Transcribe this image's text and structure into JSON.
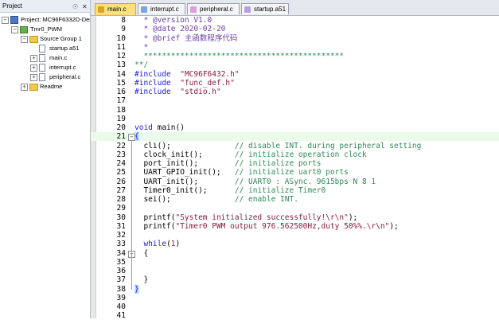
{
  "project_panel": {
    "title": "Project",
    "pin_icon": "pin-icon",
    "close_icon": "close-icon",
    "tree": [
      {
        "label": "Project: MC96F6332D-Den",
        "indent": 0,
        "expander": "−",
        "icon": "project"
      },
      {
        "label": "Tmr0_PWM",
        "indent": 1,
        "expander": "−",
        "icon": "target"
      },
      {
        "label": "Source Group 1",
        "indent": 2,
        "expander": "−",
        "icon": "folder"
      },
      {
        "label": "startup.a51",
        "indent": 3,
        "expander": "",
        "icon": "file"
      },
      {
        "label": "main.c",
        "indent": 3,
        "expander": "+",
        "icon": "file"
      },
      {
        "label": "interrupt.c",
        "indent": 3,
        "expander": "+",
        "icon": "file"
      },
      {
        "label": "peripheral.c",
        "indent": 3,
        "expander": "+",
        "icon": "file"
      },
      {
        "label": "Readme",
        "indent": 2,
        "expander": "+",
        "icon": "folder"
      }
    ]
  },
  "tabs": [
    {
      "label": "main.c",
      "active": true,
      "color": "#e0a020"
    },
    {
      "label": "interrupt.c",
      "active": false,
      "color": "#7aa7e0"
    },
    {
      "label": "peripheral.c",
      "active": false,
      "color": "#d9a0d9"
    },
    {
      "label": "startup.a51",
      "active": false,
      "color": "#b8a0e0"
    }
  ],
  "editor": {
    "current_line": 21,
    "lines": [
      {
        "n": "8",
        "text": "  * @version V1.0",
        "cls": "c-comment"
      },
      {
        "n": "9",
        "text": "  * @date 2020-02-20",
        "cls": "c-comment"
      },
      {
        "n": "10",
        "text": "  * @brief 主函数程序代码",
        "cls": "c-comment"
      },
      {
        "n": "11",
        "text": "  *",
        "cls": "c-comment"
      },
      {
        "n": "12",
        "text": "  ********************************************",
        "cls": "c-green"
      },
      {
        "n": "13",
        "text": "**/",
        "cls": "c-green"
      },
      {
        "n": "14",
        "text": "#include  \"MC96F6432.h\"",
        "cls": "inc"
      },
      {
        "n": "15",
        "text": "#include  \"func_def.h\"",
        "cls": "inc"
      },
      {
        "n": "16",
        "text": "#include  \"stdio.h\"",
        "cls": "inc"
      },
      {
        "n": "17",
        "text": "",
        "cls": "c-plain"
      },
      {
        "n": "18",
        "text": "",
        "cls": "c-plain"
      },
      {
        "n": "19",
        "text": "",
        "cls": "c-plain"
      },
      {
        "n": "20",
        "text": "void main()",
        "cls": "fn"
      },
      {
        "n": "21",
        "text": "{",
        "cls": "open"
      },
      {
        "n": "22",
        "text": "  cli();",
        "comment": "// disable INT. during peripheral setting"
      },
      {
        "n": "23",
        "text": "  clock_init();",
        "comment": "// initialize operation clock"
      },
      {
        "n": "24",
        "text": "  port_init();",
        "comment": "// initialize ports"
      },
      {
        "n": "25",
        "text": "  UART_GPIO_init();",
        "comment": "// initialize uart0 ports"
      },
      {
        "n": "26",
        "text": "  UART_init();",
        "comment": "// UART0 : ASync. 9615bps N 8 1"
      },
      {
        "n": "27",
        "text": "  Timer0_init();",
        "comment": "// initialize Timer0"
      },
      {
        "n": "28",
        "text": "  sei();",
        "comment": "// enable INT."
      },
      {
        "n": "29",
        "text": "",
        "cls": "c-plain"
      },
      {
        "n": "30",
        "text": "  printf(\"System initialized successfully!\\r\\n\");",
        "cls": "printf"
      },
      {
        "n": "31",
        "text": "  printf(\"Timer0 PWM output 976.562500Hz,duty 50%%.\\r\\n\");",
        "cls": "printf"
      },
      {
        "n": "32",
        "text": "",
        "cls": "c-plain"
      },
      {
        "n": "33",
        "text": "  while(1)",
        "cls": "while"
      },
      {
        "n": "34",
        "text": "  {",
        "cls": "c-plain"
      },
      {
        "n": "35",
        "text": "",
        "cls": "c-plain"
      },
      {
        "n": "36",
        "text": "",
        "cls": "c-plain"
      },
      {
        "n": "37",
        "text": "  }",
        "cls": "c-plain"
      },
      {
        "n": "38",
        "text": "}",
        "cls": "close"
      },
      {
        "n": "39",
        "text": "",
        "cls": "c-plain"
      },
      {
        "n": "40",
        "text": "",
        "cls": "c-plain"
      },
      {
        "n": "41",
        "text": "",
        "cls": "c-plain"
      }
    ]
  }
}
